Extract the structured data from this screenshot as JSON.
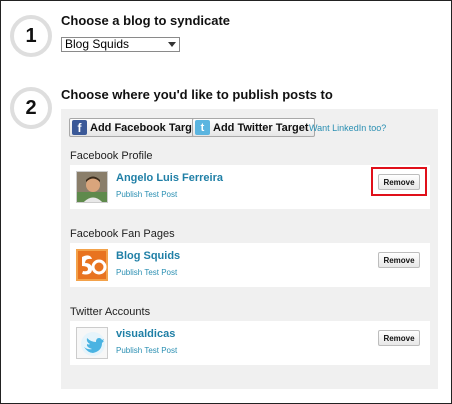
{
  "step1": {
    "number": "1",
    "title": "Choose a blog to syndicate",
    "select_value": "Blog Squids"
  },
  "step2": {
    "number": "2",
    "title": "Choose where you'd like to publish posts to"
  },
  "buttons": {
    "add_facebook": "Add Facebook Target",
    "add_twitter": "Add Twitter Target",
    "linkedin_link": "Want LinkedIn too?"
  },
  "sections": [
    {
      "heading": "Facebook Profile",
      "name": "Angelo Luis Ferreira",
      "publish": "Publish Test Post",
      "remove": "Remove"
    },
    {
      "heading": "Facebook Fan Pages",
      "name": "Blog Squids",
      "publish": "Publish Test Post",
      "remove": "Remove"
    },
    {
      "heading": "Twitter Accounts",
      "name": "visualdicas",
      "publish": "Publish Test Post",
      "remove": "Remove"
    }
  ],
  "icons": {
    "facebook": "facebook-icon",
    "twitter": "twitter-icon",
    "dropdown": "chevron-down-icon"
  },
  "colors": {
    "link": "#1f7fa6",
    "highlight": "#e0101a",
    "panel": "#f0f0f0",
    "facebook": "#3b5998",
    "twitter": "#5bb5e0"
  }
}
